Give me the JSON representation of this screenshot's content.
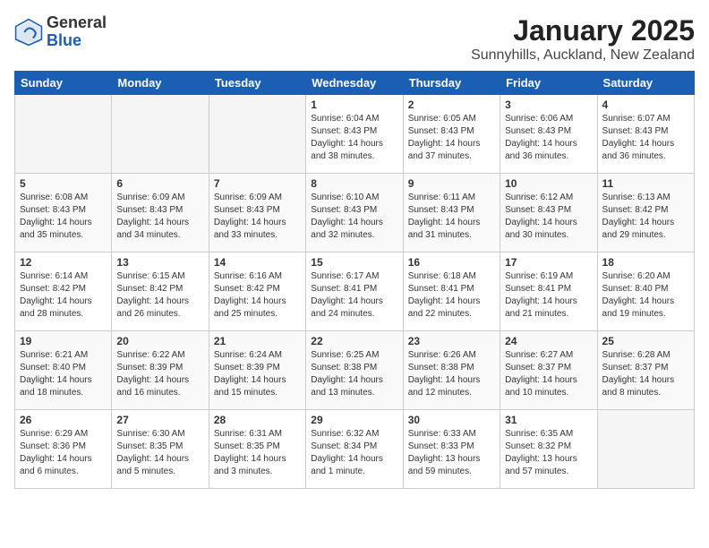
{
  "logo": {
    "general": "General",
    "blue": "Blue"
  },
  "title": "January 2025",
  "subtitle": "Sunnyhills, Auckland, New Zealand",
  "weekdays": [
    "Sunday",
    "Monday",
    "Tuesday",
    "Wednesday",
    "Thursday",
    "Friday",
    "Saturday"
  ],
  "weeks": [
    [
      {
        "day": "",
        "info": ""
      },
      {
        "day": "",
        "info": ""
      },
      {
        "day": "",
        "info": ""
      },
      {
        "day": "1",
        "info": "Sunrise: 6:04 AM\nSunset: 8:43 PM\nDaylight: 14 hours\nand 38 minutes."
      },
      {
        "day": "2",
        "info": "Sunrise: 6:05 AM\nSunset: 8:43 PM\nDaylight: 14 hours\nand 37 minutes."
      },
      {
        "day": "3",
        "info": "Sunrise: 6:06 AM\nSunset: 8:43 PM\nDaylight: 14 hours\nand 36 minutes."
      },
      {
        "day": "4",
        "info": "Sunrise: 6:07 AM\nSunset: 8:43 PM\nDaylight: 14 hours\nand 36 minutes."
      }
    ],
    [
      {
        "day": "5",
        "info": "Sunrise: 6:08 AM\nSunset: 8:43 PM\nDaylight: 14 hours\nand 35 minutes."
      },
      {
        "day": "6",
        "info": "Sunrise: 6:09 AM\nSunset: 8:43 PM\nDaylight: 14 hours\nand 34 minutes."
      },
      {
        "day": "7",
        "info": "Sunrise: 6:09 AM\nSunset: 8:43 PM\nDaylight: 14 hours\nand 33 minutes."
      },
      {
        "day": "8",
        "info": "Sunrise: 6:10 AM\nSunset: 8:43 PM\nDaylight: 14 hours\nand 32 minutes."
      },
      {
        "day": "9",
        "info": "Sunrise: 6:11 AM\nSunset: 8:43 PM\nDaylight: 14 hours\nand 31 minutes."
      },
      {
        "day": "10",
        "info": "Sunrise: 6:12 AM\nSunset: 8:43 PM\nDaylight: 14 hours\nand 30 minutes."
      },
      {
        "day": "11",
        "info": "Sunrise: 6:13 AM\nSunset: 8:42 PM\nDaylight: 14 hours\nand 29 minutes."
      }
    ],
    [
      {
        "day": "12",
        "info": "Sunrise: 6:14 AM\nSunset: 8:42 PM\nDaylight: 14 hours\nand 28 minutes."
      },
      {
        "day": "13",
        "info": "Sunrise: 6:15 AM\nSunset: 8:42 PM\nDaylight: 14 hours\nand 26 minutes."
      },
      {
        "day": "14",
        "info": "Sunrise: 6:16 AM\nSunset: 8:42 PM\nDaylight: 14 hours\nand 25 minutes."
      },
      {
        "day": "15",
        "info": "Sunrise: 6:17 AM\nSunset: 8:41 PM\nDaylight: 14 hours\nand 24 minutes."
      },
      {
        "day": "16",
        "info": "Sunrise: 6:18 AM\nSunset: 8:41 PM\nDaylight: 14 hours\nand 22 minutes."
      },
      {
        "day": "17",
        "info": "Sunrise: 6:19 AM\nSunset: 8:41 PM\nDaylight: 14 hours\nand 21 minutes."
      },
      {
        "day": "18",
        "info": "Sunrise: 6:20 AM\nSunset: 8:40 PM\nDaylight: 14 hours\nand 19 minutes."
      }
    ],
    [
      {
        "day": "19",
        "info": "Sunrise: 6:21 AM\nSunset: 8:40 PM\nDaylight: 14 hours\nand 18 minutes."
      },
      {
        "day": "20",
        "info": "Sunrise: 6:22 AM\nSunset: 8:39 PM\nDaylight: 14 hours\nand 16 minutes."
      },
      {
        "day": "21",
        "info": "Sunrise: 6:24 AM\nSunset: 8:39 PM\nDaylight: 14 hours\nand 15 minutes."
      },
      {
        "day": "22",
        "info": "Sunrise: 6:25 AM\nSunset: 8:38 PM\nDaylight: 14 hours\nand 13 minutes."
      },
      {
        "day": "23",
        "info": "Sunrise: 6:26 AM\nSunset: 8:38 PM\nDaylight: 14 hours\nand 12 minutes."
      },
      {
        "day": "24",
        "info": "Sunrise: 6:27 AM\nSunset: 8:37 PM\nDaylight: 14 hours\nand 10 minutes."
      },
      {
        "day": "25",
        "info": "Sunrise: 6:28 AM\nSunset: 8:37 PM\nDaylight: 14 hours\nand 8 minutes."
      }
    ],
    [
      {
        "day": "26",
        "info": "Sunrise: 6:29 AM\nSunset: 8:36 PM\nDaylight: 14 hours\nand 6 minutes."
      },
      {
        "day": "27",
        "info": "Sunrise: 6:30 AM\nSunset: 8:35 PM\nDaylight: 14 hours\nand 5 minutes."
      },
      {
        "day": "28",
        "info": "Sunrise: 6:31 AM\nSunset: 8:35 PM\nDaylight: 14 hours\nand 3 minutes."
      },
      {
        "day": "29",
        "info": "Sunrise: 6:32 AM\nSunset: 8:34 PM\nDaylight: 14 hours\nand 1 minute."
      },
      {
        "day": "30",
        "info": "Sunrise: 6:33 AM\nSunset: 8:33 PM\nDaylight: 13 hours\nand 59 minutes."
      },
      {
        "day": "31",
        "info": "Sunrise: 6:35 AM\nSunset: 8:32 PM\nDaylight: 13 hours\nand 57 minutes."
      },
      {
        "day": "",
        "info": ""
      }
    ]
  ]
}
